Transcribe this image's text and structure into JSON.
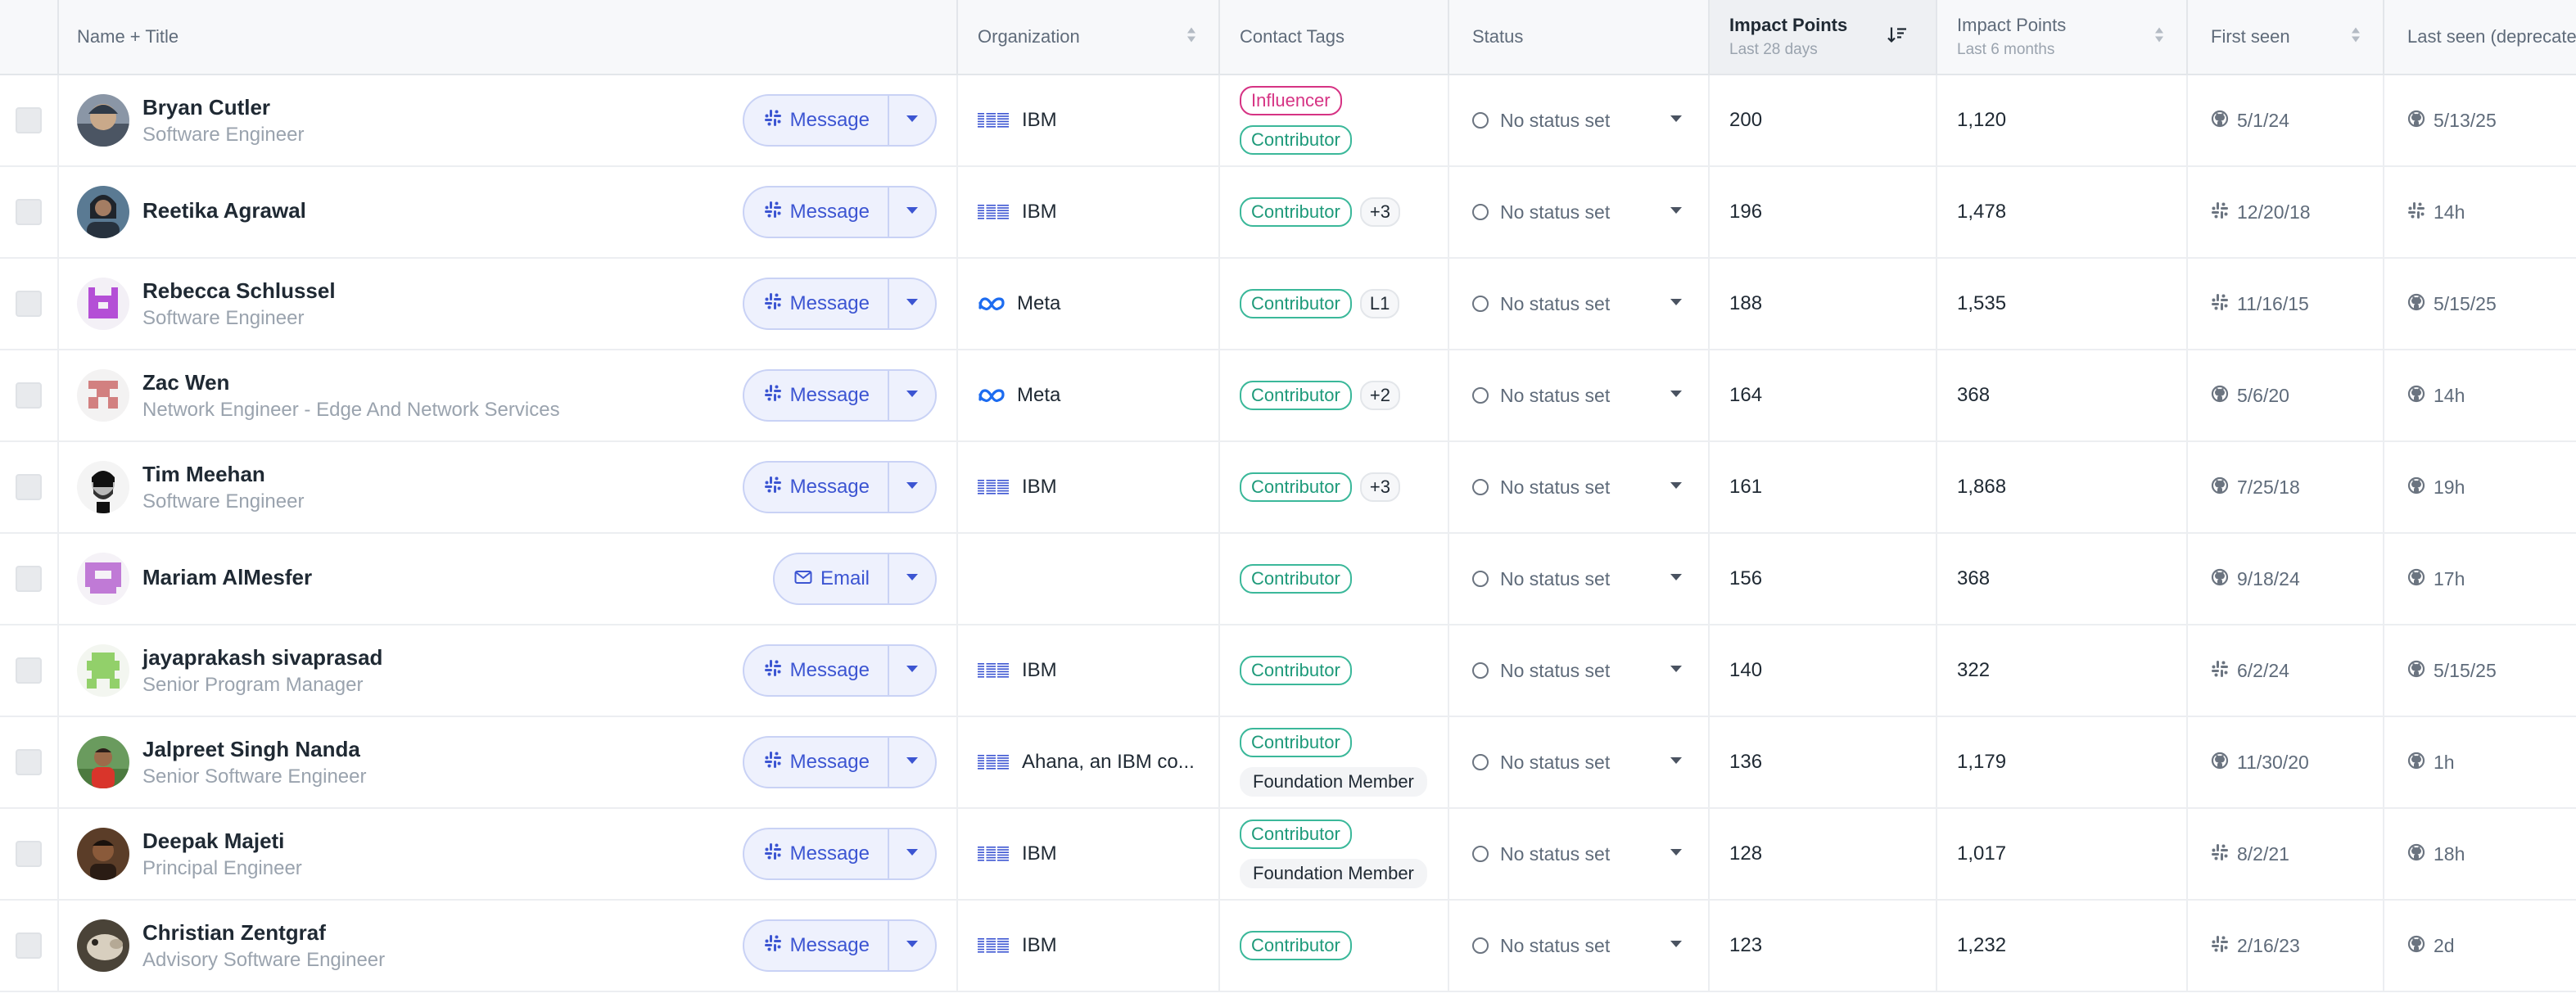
{
  "columns": {
    "name": "Name + Title",
    "organization": "Organization",
    "contact_tags": "Contact Tags",
    "status": "Status",
    "impact_28": {
      "title": "Impact Points",
      "sub": "Last 28 days"
    },
    "impact_6m": {
      "title": "Impact Points",
      "sub": "Last 6 months"
    },
    "first_seen": "First seen",
    "last_seen": "Last seen (deprecate"
  },
  "colors": {
    "accent": "#3c55d2",
    "influencer": "#d63384",
    "contributor": "#1e9a7a"
  },
  "rows": [
    {
      "name": "Bryan Cutler",
      "title": "Software Engineer",
      "avatar": "photo-helmet",
      "action": "Message",
      "action_icon": "slack-icon",
      "org": "IBM",
      "org_icon": "ibm-logo",
      "tags_line1": [
        "Influencer"
      ],
      "tags_line2": [
        "Contributor"
      ],
      "status": "No status set",
      "ip28": "200",
      "ip6": "1,120",
      "first_src": "github-icon",
      "first": "5/1/24",
      "last_src": "github-icon",
      "last": "5/13/25"
    },
    {
      "name": "Reetika Agrawal",
      "title": "",
      "avatar": "photo-woman",
      "action": "Message",
      "action_icon": "slack-icon",
      "org": "IBM",
      "org_icon": "ibm-logo",
      "tags_line1": [
        "Contributor",
        "+3"
      ],
      "tags_line2": [],
      "status": "No status set",
      "ip28": "196",
      "ip6": "1,478",
      "first_src": "slack-icon",
      "first": "12/20/18",
      "last_src": "slack-icon",
      "last": "14h"
    },
    {
      "name": "Rebecca Schlussel",
      "title": "Software Engineer",
      "avatar": "identicon-purple",
      "action": "Message",
      "action_icon": "slack-icon",
      "org": "Meta",
      "org_icon": "meta-logo",
      "tags_line1": [
        "Contributor",
        "L1"
      ],
      "tags_line2": [],
      "status": "No status set",
      "ip28": "188",
      "ip6": "1,535",
      "first_src": "slack-icon",
      "first": "11/16/15",
      "last_src": "github-icon",
      "last": "5/15/25"
    },
    {
      "name": "Zac Wen",
      "title": "Network Engineer - Edge And Network Services",
      "avatar": "identicon-red",
      "action": "Message",
      "action_icon": "slack-icon",
      "org": "Meta",
      "org_icon": "meta-logo",
      "tags_line1": [
        "Contributor",
        "+2"
      ],
      "tags_line2": [],
      "status": "No status set",
      "ip28": "164",
      "ip6": "368",
      "first_src": "github-icon",
      "first": "5/6/20",
      "last_src": "github-icon",
      "last": "14h"
    },
    {
      "name": "Tim Meehan",
      "title": "Software Engineer",
      "avatar": "photo-bw",
      "action": "Message",
      "action_icon": "slack-icon",
      "org": "IBM",
      "org_icon": "ibm-logo",
      "tags_line1": [
        "Contributor",
        "+3"
      ],
      "tags_line2": [],
      "status": "No status set",
      "ip28": "161",
      "ip6": "1,868",
      "first_src": "github-icon",
      "first": "7/25/18",
      "last_src": "github-icon",
      "last": "19h"
    },
    {
      "name": "Mariam AlMesfer",
      "title": "",
      "avatar": "identicon-violet",
      "action": "Email",
      "action_icon": "mail-icon",
      "org": "",
      "org_icon": "",
      "tags_line1": [
        "Contributor"
      ],
      "tags_line2": [],
      "status": "No status set",
      "ip28": "156",
      "ip6": "368",
      "first_src": "github-icon",
      "first": "9/18/24",
      "last_src": "github-icon",
      "last": "17h"
    },
    {
      "name": "jayaprakash sivaprasad",
      "title": "Senior Program Manager",
      "avatar": "identicon-green",
      "action": "Message",
      "action_icon": "slack-icon",
      "org": "IBM",
      "org_icon": "ibm-logo",
      "tags_line1": [
        "Contributor"
      ],
      "tags_line2": [],
      "status": "No status set",
      "ip28": "140",
      "ip6": "322",
      "first_src": "slack-icon",
      "first": "6/2/24",
      "last_src": "github-icon",
      "last": "5/15/25"
    },
    {
      "name": "Jalpreet Singh Nanda",
      "title": "Senior Software Engineer",
      "avatar": "photo-outdoor",
      "action": "Message",
      "action_icon": "slack-icon",
      "org": "Ahana, an IBM co...",
      "org_icon": "ibm-logo",
      "tags_line1": [
        "Contributor"
      ],
      "tags_line2": [
        "Foundation Member"
      ],
      "status": "No status set",
      "ip28": "136",
      "ip6": "1,179",
      "first_src": "github-icon",
      "first": "11/30/20",
      "last_src": "github-icon",
      "last": "1h"
    },
    {
      "name": "Deepak Majeti",
      "title": "Principal Engineer",
      "avatar": "photo-man",
      "action": "Message",
      "action_icon": "slack-icon",
      "org": "IBM",
      "org_icon": "ibm-logo",
      "tags_line1": [
        "Contributor"
      ],
      "tags_line2": [
        "Foundation Member"
      ],
      "status": "No status set",
      "ip28": "128",
      "ip6": "1,017",
      "first_src": "slack-icon",
      "first": "8/2/21",
      "last_src": "github-icon",
      "last": "18h"
    },
    {
      "name": "Christian Zentgraf",
      "title": "Advisory Software Engineer",
      "avatar": "photo-animal",
      "action": "Message",
      "action_icon": "slack-icon",
      "org": "IBM",
      "org_icon": "ibm-logo",
      "tags_line1": [
        "Contributor"
      ],
      "tags_line2": [],
      "status": "No status set",
      "ip28": "123",
      "ip6": "1,232",
      "first_src": "slack-icon",
      "first": "2/16/23",
      "last_src": "github-icon",
      "last": "2d"
    }
  ]
}
